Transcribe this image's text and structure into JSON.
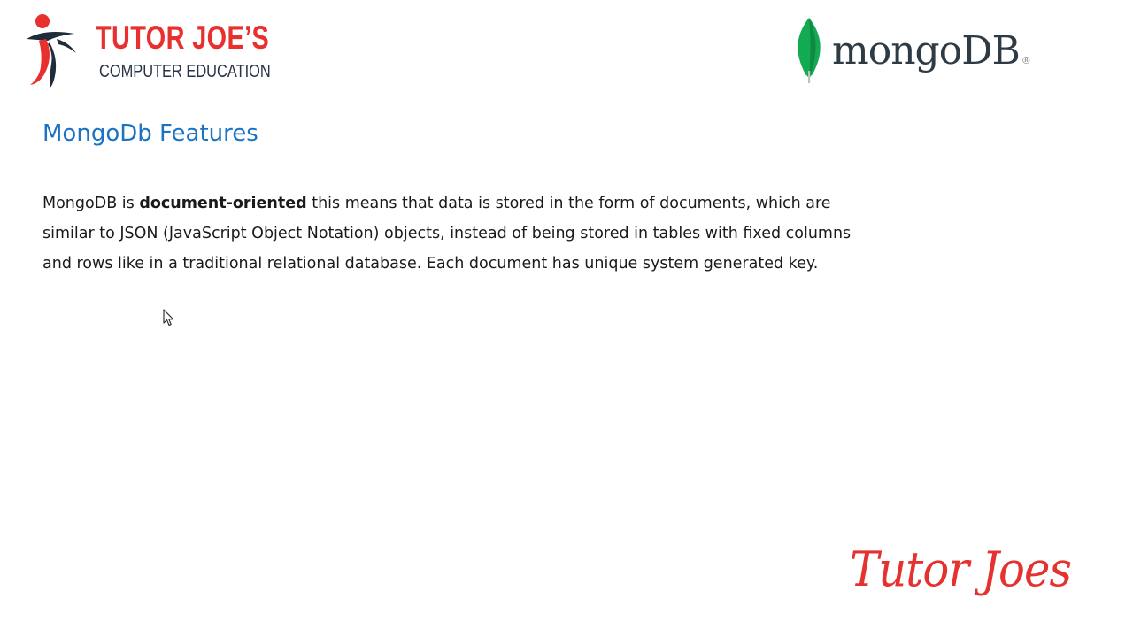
{
  "brand": {
    "name": "TUTOR JOE’S",
    "tagline": "COMPUTER EDUCATION"
  },
  "mongo": {
    "wordmark": "mongoDB",
    "registered": "®",
    "leaf_color": "#13aa52"
  },
  "slide": {
    "title": "MongoDb Features",
    "paragraph": {
      "lead": "MongoDB is ",
      "emphasis": "document-oriented",
      "rest": " this means that data is stored in the form of documents, which are similar to JSON (JavaScript Object Notation) objects, instead of being stored in tables with fixed columns and rows like in a traditional relational database. Each document has unique system generated key."
    }
  },
  "signature": "Tutor Joes",
  "colors": {
    "title": "#1c73c4",
    "brand_red": "#e8302f",
    "text": "#1a1a1a"
  },
  "icons": {
    "cursor": "arrow-cursor-icon",
    "brand": "person-figure-icon",
    "mongo": "leaf-icon"
  }
}
